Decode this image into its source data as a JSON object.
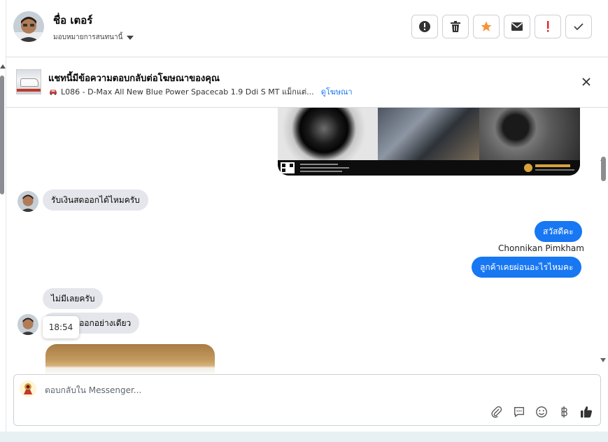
{
  "header": {
    "contact_name": "ชื่อ เตอร์",
    "assign_label": "มอบหมายการสนทนานี้",
    "actions": [
      {
        "name": "mark-spam-button",
        "icon": "alert-circle-icon"
      },
      {
        "name": "delete-button",
        "icon": "trash-icon"
      },
      {
        "name": "star-button",
        "icon": "star-icon"
      },
      {
        "name": "mark-unread-button",
        "icon": "envelope-icon"
      },
      {
        "name": "mark-important-button",
        "icon": "exclamation-icon"
      },
      {
        "name": "mark-done-button",
        "icon": "checkmark-icon"
      }
    ]
  },
  "ad_banner": {
    "title": "แชทนี้มีข้อความตอบกลับต่อโฆษณาของคุณ",
    "subtitle": "L086 - D-Max All New Blue Power Spacecab 1.9 Ddi S MT แม็กแต่...",
    "link_label": "ดูโฆษณา",
    "close_icon": "close-icon"
  },
  "messages": [
    {
      "direction": "in",
      "text": "รับเงินสดออกได้ไหมครับ"
    },
    {
      "direction": "out",
      "text": "สวัสดีคะ"
    },
    {
      "direction": "out",
      "sender": "Chonnikan Pimkham",
      "text": "ลูกค้าเคยผ่อนอะไรไหมคะ"
    },
    {
      "direction": "in",
      "text": "ไม่มีเลยครับ"
    },
    {
      "direction": "in",
      "text": "ขายเก่าออกอย่างเดียว"
    }
  ],
  "tooltip_time": "18:54",
  "composer": {
    "placeholder": "ตอบกลับใน Messenger...",
    "tools": [
      "paperclip-icon",
      "saved-reply-icon",
      "emoji-icon",
      "baht-icon",
      "thumbs-up-icon"
    ]
  },
  "colors": {
    "accent": "#1877f2",
    "star": "#f7923a",
    "important": "#e02424",
    "incoming_bubble": "#e4e6eb"
  }
}
